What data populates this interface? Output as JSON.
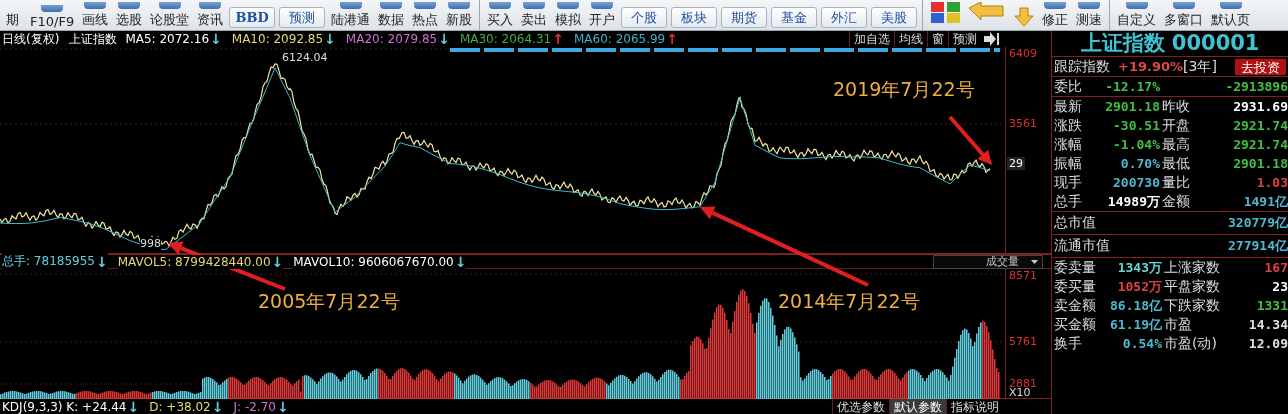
{
  "toolbar": {
    "items": [
      {
        "kind": "tool",
        "label": "期"
      },
      {
        "kind": "tool",
        "label": "F10/F9"
      },
      {
        "kind": "tool",
        "label": "画线"
      },
      {
        "kind": "tool",
        "label": "选股"
      },
      {
        "kind": "tool",
        "label": "论股堂"
      },
      {
        "kind": "tool",
        "label": "资讯"
      },
      {
        "kind": "tab",
        "label": "BBD"
      },
      {
        "kind": "tab",
        "label": "预测"
      },
      {
        "kind": "tool",
        "label": "陆港通"
      },
      {
        "kind": "tool",
        "label": "数据"
      },
      {
        "kind": "tool",
        "label": "热点"
      },
      {
        "kind": "tool",
        "label": "新股"
      },
      {
        "kind": "separator"
      },
      {
        "kind": "tool",
        "label": "买入"
      },
      {
        "kind": "tool",
        "label": "卖出"
      },
      {
        "kind": "tool",
        "label": "模拟"
      },
      {
        "kind": "tool",
        "label": "开户"
      },
      {
        "kind": "tab",
        "label": "个股"
      },
      {
        "kind": "tab",
        "label": "板块"
      },
      {
        "kind": "tab",
        "label": "期货"
      },
      {
        "kind": "tab",
        "label": "基金"
      },
      {
        "kind": "tab",
        "label": "外汇"
      },
      {
        "kind": "tab",
        "label": "美股"
      },
      {
        "kind": "separator"
      },
      {
        "kind": "grid"
      },
      {
        "kind": "back"
      },
      {
        "kind": "down"
      },
      {
        "kind": "tool",
        "label": "修正"
      },
      {
        "kind": "tool",
        "label": "测速"
      },
      {
        "kind": "separator"
      },
      {
        "kind": "tool",
        "label": "自定义"
      },
      {
        "kind": "tool",
        "label": "多窗口"
      },
      {
        "kind": "tool",
        "label": "默认页"
      }
    ]
  },
  "info_bar": {
    "period": "日线(复权)",
    "name": "上证指数",
    "indicators": [
      {
        "label": "MA5: 2072.16",
        "color": "#ffffff",
        "arrow": {
          "text": "↓",
          "color": "#60d0e0"
        }
      },
      {
        "label": "MA10: 2092.85",
        "color": "#e8d870",
        "arrow": {
          "text": "↓",
          "color": "#60d0e0"
        }
      },
      {
        "label": "MA20: 2079.85",
        "color": "#d070d0",
        "arrow": {
          "text": "↓",
          "color": "#60d0e0"
        }
      },
      {
        "label": "MA30: 2064.31",
        "color": "#40b040",
        "arrow": {
          "text": "↑",
          "color": "#e03030"
        }
      },
      {
        "label": "MA60: 2065.99",
        "color": "#40b0c8",
        "arrow": {
          "text": "↑",
          "color": "#e03030"
        }
      }
    ],
    "buttons": [
      "加自选",
      "均线",
      "窗",
      "预测"
    ]
  },
  "main_chart": {
    "axis_labels": [
      "6409",
      "3561"
    ],
    "current_price": "29",
    "peak_label": "6124.04",
    "low_label": "998",
    "annotations": [
      "2005年7月22号",
      "2014年7月22号",
      "2019年7月22号"
    ]
  },
  "volume_bar": {
    "indicators": [
      {
        "label": "总手: 78185955",
        "color": "#60d0e0",
        "arrow": {
          "text": "↓",
          "color": "#60d0e0"
        }
      },
      {
        "label": "MAVOL5: 8799428440.00",
        "color": "#e8d870",
        "arrow": {
          "text": "↓",
          "color": "#60d0e0"
        }
      },
      {
        "label": "MAVOL10: 9606067670.00",
        "color": "#ffffff",
        "arrow": {
          "text": "↓",
          "color": "#60d0e0"
        }
      }
    ],
    "selector": "成交量"
  },
  "volume_chart": {
    "axis_labels": [
      "8571",
      "5761",
      "2881",
      "X10"
    ]
  },
  "kdj_bar": {
    "indicators": [
      {
        "label": "KDJ(9,3,3) K: +24.44",
        "color": "#ffffff",
        "arrow": {
          "text": "↓",
          "color": "#60d0e0"
        }
      },
      {
        "label": "D: +38.02",
        "color": "#e8d870",
        "arrow": {
          "text": "↓",
          "color": "#60d0e0"
        }
      },
      {
        "label": "J: -2.70",
        "color": "#d070d0",
        "arrow": {
          "text": "↓",
          "color": "#60d0e0"
        }
      }
    ],
    "buttons": [
      {
        "label": "优选参数",
        "selected": false
      },
      {
        "label": "默认参数",
        "selected": true
      },
      {
        "label": "指标说明",
        "selected": false
      }
    ]
  },
  "quote": {
    "title": "上证指数 000001",
    "tracking": {
      "label": "跟踪指数",
      "value": "+19.90%",
      "period": "[3年]",
      "button": "去投资"
    },
    "ratio": {
      "label": "委比",
      "value": "-12.17%",
      "amount": "-2913896",
      "color": "#40c040"
    },
    "rows": [
      {
        "left": {
          "label": "最新",
          "value": "2901.18",
          "color": "#40c040"
        },
        "right": {
          "label": "昨收",
          "value": "2931.69",
          "color": "#ffffff"
        }
      },
      {
        "left": {
          "label": "涨跌",
          "value": "-30.51",
          "color": "#40c040"
        },
        "right": {
          "label": "开盘",
          "value": "2921.74",
          "color": "#40c040"
        }
      },
      {
        "left": {
          "label": "涨幅",
          "value": "-1.04%",
          "color": "#40c040"
        },
        "right": {
          "label": "最高",
          "value": "2921.74",
          "color": "#40c040"
        }
      },
      {
        "left": {
          "label": "振幅",
          "value": "0.70%",
          "color": "#50b8d0"
        },
        "right": {
          "label": "最低",
          "value": "2901.18",
          "color": "#40c040"
        }
      },
      {
        "left": {
          "label": "现手",
          "value": "200730",
          "color": "#50b8d0"
        },
        "right": {
          "label": "量比",
          "value": "1.03",
          "color": "#e04040"
        }
      },
      {
        "left": {
          "label": "总手",
          "value": "14989万",
          "color": "#ffffff"
        },
        "right": {
          "label": "金额",
          "value": "1491亿",
          "color": "#50b8d0"
        }
      }
    ],
    "totals": [
      {
        "label": "总市值",
        "value": "320779亿"
      },
      {
        "label": "流通市值",
        "value": "277914亿"
      }
    ],
    "rows2": [
      {
        "left": {
          "label": "委卖量",
          "value": "1343万",
          "color": "#60d8d0"
        },
        "right": {
          "label": "上涨家数",
          "value": "167",
          "color": "#e04040"
        }
      },
      {
        "left": {
          "label": "委买量",
          "value": "1052万",
          "color": "#e04040"
        },
        "right": {
          "label": "平盘家数",
          "value": "23",
          "color": "#ffffff"
        }
      },
      {
        "left": {
          "label": "卖金额",
          "value": "86.18亿",
          "color": "#50b8d0"
        },
        "right": {
          "label": "下跌家数",
          "value": "1331",
          "color": "#40c040"
        }
      },
      {
        "left": {
          "label": "买金额",
          "value": "61.19亿",
          "color": "#50b8d0"
        },
        "right": {
          "label": "市盈",
          "value": "14.34",
          "color": "#e0e0e0"
        }
      },
      {
        "left": {
          "label": "换手",
          "value": "0.54%",
          "color": "#50b8d0"
        },
        "right": {
          "label": "市盈(动)",
          "value": "12.09",
          "color": "#e0e0e0"
        }
      }
    ]
  }
}
